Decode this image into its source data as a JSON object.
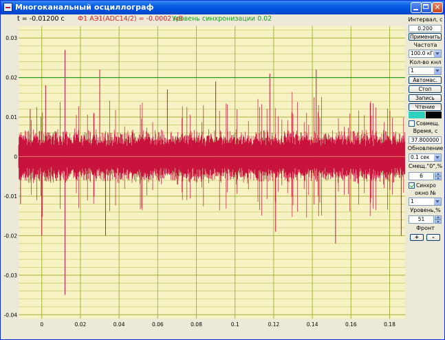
{
  "window": {
    "title": "Многоканальный осциллограф"
  },
  "readouts": {
    "time": "t = -0.01200 с",
    "channel": "Ф1 АЭ1(ADC14/2) =      -0.0002 мВ",
    "sync": "Уровень синхронизации     0.02"
  },
  "panel": {
    "interval_label": "Интервал, с",
    "interval_value": "0.200",
    "apply_button": "Применить",
    "frequency_label": "Частота",
    "frequency_value": "100.0 кГц",
    "channels_label": "Кол-во кнл",
    "channels_value": "1",
    "auto_button": "Автомас.",
    "stop_button": "Стоп",
    "record_button": "Запись",
    "read_button": "Чтение",
    "combine_label": "Совмещ.",
    "time_label": "Время, с",
    "time_value": "37.800000",
    "update_label": "Обновление",
    "update_value": "0.1 сек",
    "offset_label": "Смещ.\"0\",%",
    "offset_value": "6",
    "sync_check_label": "Синхро",
    "window_label": "окно №",
    "window_value": "1",
    "level_label": "Уровень,%",
    "level_value": "51",
    "front_label": "Фронт",
    "plus_button": "+",
    "minus_button": "-"
  },
  "colors": {
    "plot_background": "#f6f2c4",
    "signal": "#c8143c",
    "grid_major": "#a8b43a",
    "grid_minor": "#c9cf72",
    "sync_line": "#28a028",
    "swatch_1": "#2ed0c0",
    "swatch_2": "#000000"
  },
  "chart_data": {
    "type": "line",
    "title": "",
    "xlabel": "",
    "ylabel": "",
    "xlim": [
      -0.012,
      0.188
    ],
    "ylim": [
      -0.041,
      0.033
    ],
    "x_ticks": [
      0,
      0.02,
      0.04,
      0.06,
      0.08,
      0.1,
      0.12,
      0.14,
      0.16,
      0.18
    ],
    "x_tick_labels": [
      "0",
      "0.02",
      "0.04",
      "0.06",
      "0.08",
      "0.1",
      "0.12",
      "0.14",
      "0.16",
      "0.18"
    ],
    "y_ticks": [
      0.03,
      0.02,
      0.01,
      0,
      -0.01,
      -0.02,
      -0.03,
      -0.04
    ],
    "y_tick_labels": [
      "0.03",
      "0.02",
      "0.01",
      "0",
      "-0.01",
      "-0.02",
      "-0.03",
      "-0.04"
    ],
    "grid": true,
    "sync_level": 0.02,
    "series": [
      {
        "signal_envelope_typical": [
          -0.006,
          0.006
        ],
        "peaks": [
          {
            "x": -0.011,
            "y": -0.012
          },
          {
            "x": -0.006,
            "y": 0.012
          },
          {
            "x": 0.002,
            "y": 0.018
          },
          {
            "x": 0.0,
            "y": -0.02
          },
          {
            "x": 0.012,
            "y": 0.027
          },
          {
            "x": 0.012,
            "y": -0.035
          },
          {
            "x": 0.03,
            "y": 0.022
          },
          {
            "x": 0.033,
            "y": -0.02
          },
          {
            "x": 0.065,
            "y": 0.017
          },
          {
            "x": 0.09,
            "y": 0.019
          },
          {
            "x": 0.118,
            "y": 0.021
          },
          {
            "x": 0.121,
            "y": -0.019
          },
          {
            "x": 0.142,
            "y": 0.022
          },
          {
            "x": 0.152,
            "y": -0.022
          },
          {
            "x": 0.186,
            "y": -0.02
          }
        ]
      }
    ]
  }
}
